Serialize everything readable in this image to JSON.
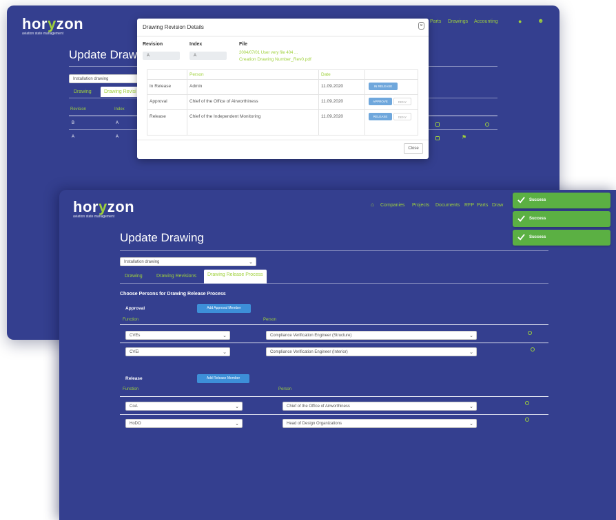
{
  "brand": {
    "name_a": "hor",
    "name_y": "y",
    "name_b": "zon",
    "tagline": "aviation state management"
  },
  "back": {
    "nav": [
      "Parts",
      "Drawings",
      "Accounting"
    ],
    "title": "Update Drawing",
    "select_value": "Installation drawing",
    "tabs": [
      "Drawing",
      "Drawing Revisi"
    ],
    "table_headers": [
      "Revision",
      "Index"
    ],
    "rows": [
      {
        "revision": "B",
        "index": "A"
      },
      {
        "revision": "A",
        "index": "A"
      }
    ]
  },
  "modal": {
    "title": "Drawing Revision Details",
    "revision_label": "Revision",
    "revision_value": "A",
    "index_label": "Index",
    "index_value": "A",
    "file_label": "File",
    "file_line1": "2004/07/01 User very file 404 ...",
    "file_line2": "Creation Drawing Number_Rev0.pdf",
    "col_person": "Person",
    "col_date": "Date",
    "rows": [
      {
        "step": "In Release",
        "person": "Admin",
        "date": "11.09.2020",
        "btn": "IN RELEASE",
        "deny": ""
      },
      {
        "step": "Approval",
        "person": "Chief of the Office of Airworthiness",
        "date": "11.09.2020",
        "btn": "APPROVE",
        "deny": "DENY"
      },
      {
        "step": "Release",
        "person": "Chief of the Independent Monitoring",
        "date": "11.09.2020",
        "btn": "RELEASE",
        "deny": "DENY"
      }
    ],
    "close": "Close"
  },
  "front": {
    "nav": [
      "Companies",
      "Projects",
      "Documents",
      "RFP",
      "Parts",
      "Draw"
    ],
    "title": "Update Drawing",
    "select_value": "Installation drawing",
    "tabs": [
      "Drawing",
      "Drawing Revisions",
      "Drawing Release Process"
    ],
    "heading": "Choose Persons for Drawing Release Process",
    "approval": {
      "label": "Approval",
      "add_btn": "Add Approval Member",
      "function_label": "Function",
      "person_label": "Person",
      "rows": [
        {
          "function": "CVEs",
          "person": "Compliance Verification Engineer (Structure)"
        },
        {
          "function": "CVEi",
          "person": "Compliance Verification Engineer (Interior)"
        }
      ]
    },
    "release": {
      "label": "Release",
      "add_btn": "Add Release Member",
      "function_label": "Function",
      "person_label": "Person",
      "rows": [
        {
          "function": "CoA",
          "person": "Chief of the Office of Airworthiness"
        },
        {
          "function": "HoDO",
          "person": "Head of Design Organizations"
        }
      ]
    }
  },
  "toasts": [
    "Success",
    "Success",
    "Success"
  ],
  "colors": {
    "bg_panel": "#343f8f",
    "accent_green": "#9fd13b",
    "button_blue": "#3d8fd8",
    "toast_green": "#5bb043"
  }
}
